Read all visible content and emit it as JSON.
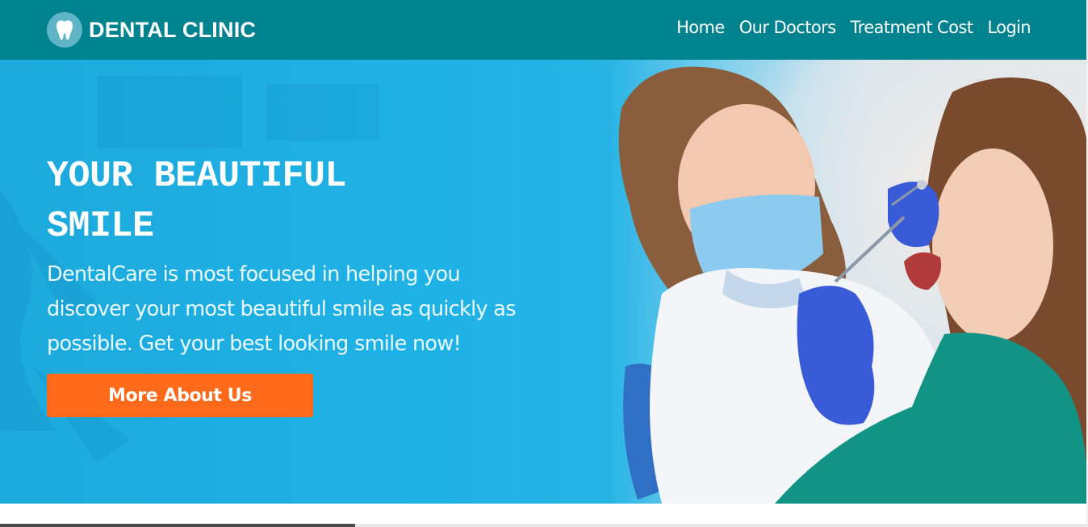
{
  "brand": {
    "name": "DENTAL CLINIC",
    "logo_icon": "tooth-icon"
  },
  "nav": {
    "items": [
      {
        "label": "Home"
      },
      {
        "label": "Our Doctors"
      },
      {
        "label": "Treatment Cost"
      },
      {
        "label": "Login"
      }
    ]
  },
  "hero": {
    "title_line1": "YOUR BEAUTIFUL",
    "title_line2": "SMILE",
    "description": "DentalCare is most focused in helping you discover your most beautiful smile as quickly as possible. Get your best looking smile now!",
    "cta_label": "More About Us"
  },
  "colors": {
    "navbar": "#00838f",
    "hero_blue": "#1fb2e6",
    "cta_orange": "#ff6a1a",
    "text_white": "#ffffff"
  }
}
